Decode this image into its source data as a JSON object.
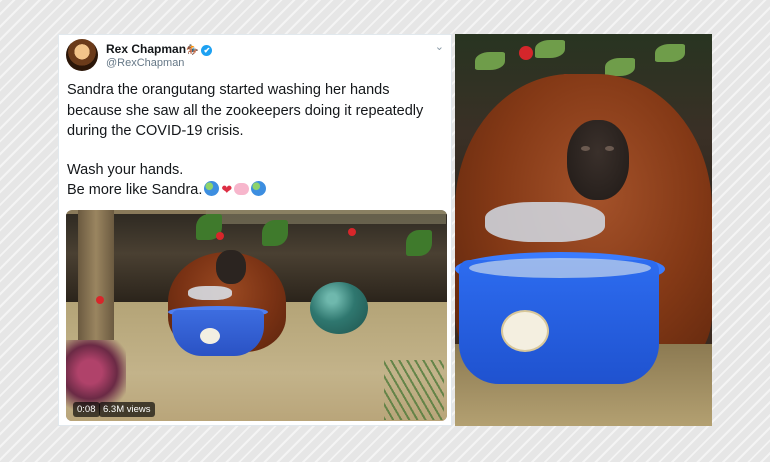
{
  "tweet": {
    "author_name": "Rex Chapman",
    "author_emoji": "🏇🏼",
    "verified_icon": "✔",
    "handle": "@RexChapman",
    "menu_caret": "⌄",
    "text_paragraph_1": "Sandra the orangutang started washing her hands because she saw all the zookeepers doing it repeatedly during the COVID-19 crisis.",
    "text_line_2": "Wash your hands.",
    "text_line_3": "Be more like Sandra.",
    "emojis": [
      "globe-emoji",
      "red-heart-emoji",
      "soap-emoji",
      "globe-emoji"
    ],
    "video": {
      "elapsed": "0:08",
      "views": "6.3M views"
    }
  },
  "colors": {
    "verified": "#1da1f2",
    "tweet_text": "#14171a",
    "handle": "#657786"
  }
}
